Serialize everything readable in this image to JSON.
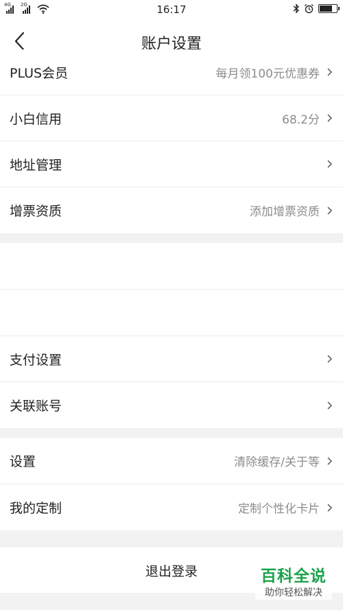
{
  "status_bar": {
    "time": "16:17",
    "signal_1": "4G",
    "signal_2": "2G",
    "battery_level": 0.75
  },
  "header": {
    "title": "账户设置"
  },
  "section_1": [
    {
      "label": "PLUS会员",
      "value": "每月领100元优惠券"
    },
    {
      "label": "小白信用",
      "value": "68.2分"
    },
    {
      "label": "地址管理",
      "value": ""
    },
    {
      "label": "增票资质",
      "value": "添加增票资质"
    }
  ],
  "section_2": [
    {
      "label": "支付设置",
      "value": ""
    },
    {
      "label": "关联账号",
      "value": ""
    }
  ],
  "section_3": [
    {
      "label": "设置",
      "value": "清除缓存/关于等"
    },
    {
      "label": "我的定制",
      "value": "定制个性化卡片"
    }
  ],
  "logout_label": "退出登录",
  "watermark": {
    "title": "百科全说",
    "subtitle": "助你轻松解决"
  },
  "colors": {
    "accent_green": "#1aa34a",
    "secondary_text": "#8c8c8c",
    "background": "#f2f2f2"
  }
}
